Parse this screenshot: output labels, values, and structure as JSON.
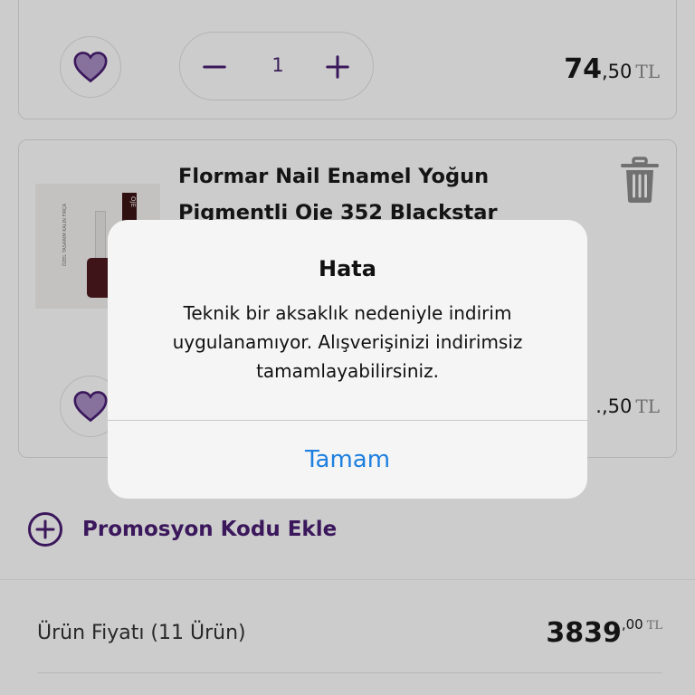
{
  "cart": {
    "items": [
      {
        "quantity": "1",
        "price_main": "74",
        "price_cents": ",50",
        "currency": "TL"
      },
      {
        "title": "Flormar Nail Enamel Yoğun Pigmentli Oje 352 Blackstar",
        "image_label": "OJE",
        "image_side_text": "ÖZEL TASARIM KALIN FIRÇA",
        "price_visible": ".,50",
        "currency": "TL"
      }
    ]
  },
  "promo": {
    "label": "Promosyon Kodu Ekle"
  },
  "summary": {
    "label": "Ürün Fiyatı (11 Ürün)",
    "price_main": "3839",
    "price_cents": ",00",
    "currency": "TL"
  },
  "alert": {
    "title": "Hata",
    "message": "Teknik bir aksaklık nedeniyle indirim uygulanamıyor. Alışverişinizi indirimsiz tamamlayabilirsiniz.",
    "button_label": "Tamam"
  },
  "colors": {
    "brand_purple": "#4a1d73",
    "heart_fill": "#a88fc4",
    "alert_button": "#1d7fe0"
  }
}
